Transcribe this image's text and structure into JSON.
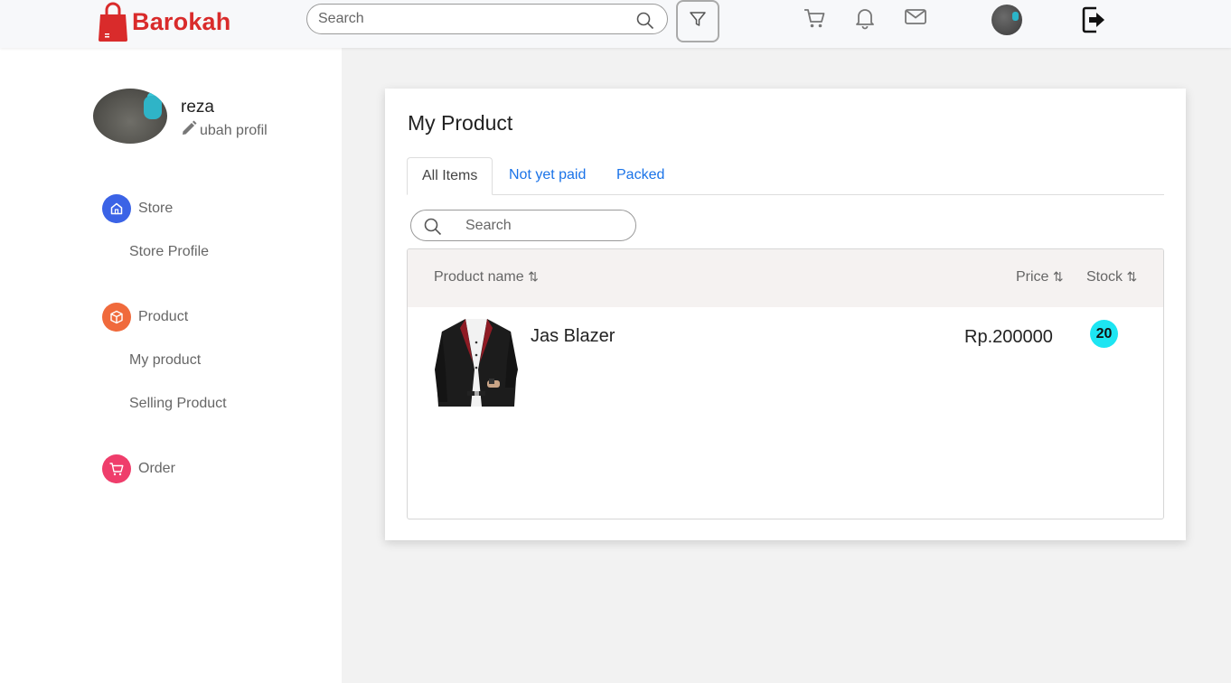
{
  "app": {
    "brand_name": "Barokah",
    "brand_color": "#d92b2b",
    "accent_link": "#1a73e8"
  },
  "header": {
    "search_placeholder": "Search",
    "icons": [
      "shopping-bag-icon",
      "search-icon",
      "filter-icon",
      "cart-icon",
      "bell-icon",
      "mail-icon",
      "avatar",
      "logout-icon"
    ]
  },
  "sidebar": {
    "profile": {
      "name": "reza",
      "edit_label": "ubah profil"
    },
    "groups": [
      {
        "label": "Store",
        "icon": "home-icon",
        "color": "#3b63e6",
        "items": [
          "Store Profile"
        ]
      },
      {
        "label": "Product",
        "icon": "box-icon",
        "color": "#f06a3c",
        "items": [
          "My product",
          "Selling Product"
        ]
      },
      {
        "label": "Order",
        "icon": "cart-icon",
        "color": "#ef3d6b",
        "items": []
      }
    ]
  },
  "main": {
    "title": "My Product",
    "tabs": [
      {
        "label": "All Items",
        "active": true
      },
      {
        "label": "Not yet paid",
        "active": false
      },
      {
        "label": "Packed",
        "active": false
      }
    ],
    "search_placeholder": "Search",
    "table": {
      "columns": [
        "Product name",
        "Price",
        "Stock"
      ],
      "sort_icon": "sort-arrows-icon",
      "rows": [
        {
          "name": "Jas Blazer",
          "price": "Rp.200000",
          "stock": "20",
          "stock_badge_color": "#1de5f2"
        }
      ]
    }
  }
}
